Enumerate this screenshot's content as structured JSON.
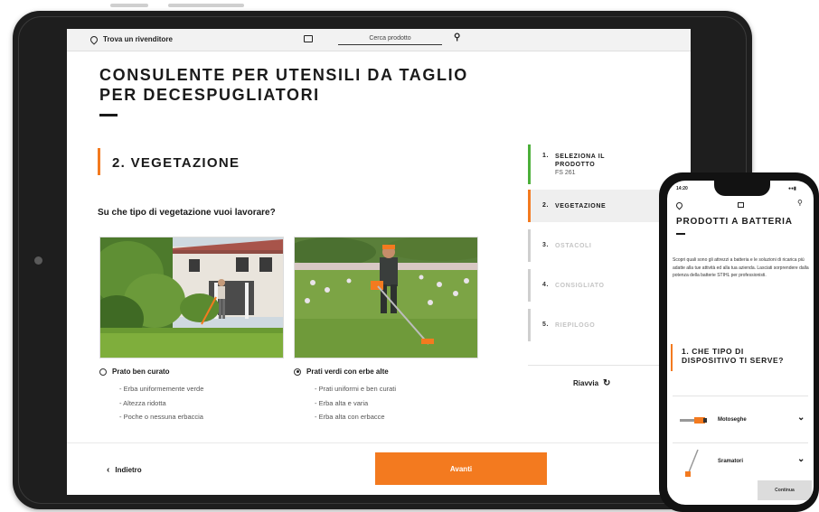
{
  "tablet": {
    "topbar": {
      "dealer_link": "Trova un rivenditore",
      "search_placeholder": "Cerca prodotto"
    },
    "page_title_line1": "CONSULENTE PER UTENSILI DA TAGLIO",
    "page_title_line2": "PER DECESPUGLIATORI",
    "step_title": "2. VEGETAZIONE",
    "question": "Su che tipo di vegetazione vuoi lavorare?",
    "options": [
      {
        "label": "Prato ben curato",
        "selected": false,
        "bullets": [
          "- Erba uniformemente verde",
          "- Altezza ridotta",
          "- Poche o nessuna erbaccia"
        ]
      },
      {
        "label": "Prati verdi con erbe alte",
        "selected": true,
        "bullets": [
          "- Prati uniformi e ben curati",
          "- Erba alta e varia",
          "- Erba alta con erbacce"
        ]
      }
    ],
    "sidebar": {
      "steps": [
        {
          "num": "1.",
          "label_line1": "SELEZIONA IL",
          "label_line2": "PRODOTTO",
          "sub": "FS 261",
          "state": "done"
        },
        {
          "num": "2.",
          "label_line1": "VEGETAZIONE",
          "label_line2": "",
          "sub": "",
          "state": "active"
        },
        {
          "num": "3.",
          "label_line1": "OSTACOLI",
          "label_line2": "",
          "sub": "",
          "state": "pending"
        },
        {
          "num": "4.",
          "label_line1": "CONSIGLIATO",
          "label_line2": "",
          "sub": "",
          "state": "pending"
        },
        {
          "num": "5.",
          "label_line1": "RIEPILOGO",
          "label_line2": "",
          "sub": "",
          "state": "pending"
        }
      ],
      "restart_label": "Riavvia"
    },
    "nav": {
      "back_label": "Indietro",
      "next_label": "Avanti"
    },
    "colors": {
      "accent": "#f37a1f",
      "done": "#4caf3a",
      "pending": "#cfcfcf"
    }
  },
  "phone": {
    "status_time": "14:20",
    "title": "PRODOTTI A BATTERIA",
    "intro": "Scopri quali sono gli attrezzi a batteria e le soluzioni di ricarica più adatte alla tue attività ed alla tua azienda. Lasciati sorprendere dalla potenza della batterie STIHL per professionisti.",
    "step_title_line1": "1. CHE TIPO DI",
    "step_title_line2": "DISPOSITIVO TI SERVE?",
    "items": [
      {
        "label": "Motoseghe",
        "icon": "chainsaw-icon"
      },
      {
        "label": "Sramatori",
        "icon": "pole-pruner-icon"
      }
    ],
    "continue_label": "Continua"
  }
}
